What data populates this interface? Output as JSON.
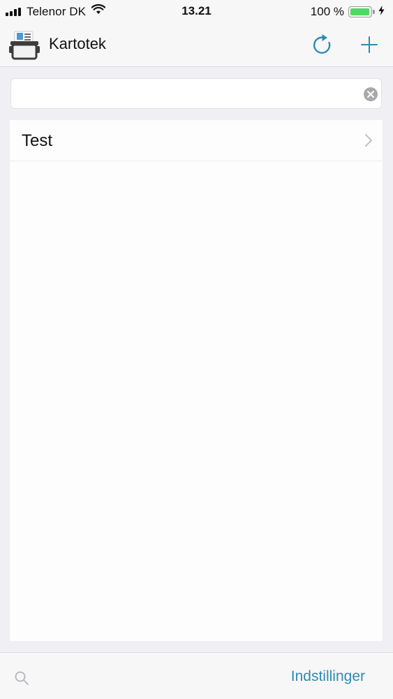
{
  "status_bar": {
    "carrier": "Telenor DK",
    "time": "13.21",
    "battery": "100 %",
    "battery_level": 1.0
  },
  "nav": {
    "title": "Kartotek",
    "icons": [
      "app-logo",
      "refresh-icon",
      "plus-icon"
    ]
  },
  "search": {
    "value": "",
    "placeholder": ""
  },
  "list": {
    "items": [
      {
        "label": "Test"
      }
    ]
  },
  "toolbar": {
    "settings_label": "Indstillinger",
    "icons": [
      "search-icon"
    ]
  },
  "colors": {
    "accent": "#2d8bb5",
    "battery": "#4cd964",
    "background": "#efeff4"
  }
}
